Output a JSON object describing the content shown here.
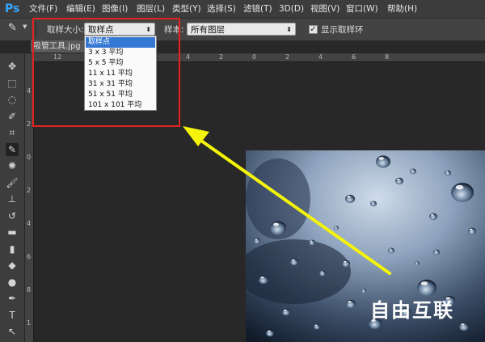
{
  "app": {
    "logo": "Ps"
  },
  "menu": [
    "文件(F)",
    "编辑(E)",
    "图像(I)",
    "图层(L)",
    "类型(Y)",
    "选择(S)",
    "滤镜(T)",
    "3D(D)",
    "视图(V)",
    "窗口(W)",
    "帮助(H)"
  ],
  "options": {
    "sample_size_label": "取样大小:",
    "sample_size_value": "取样点",
    "sample_label": "样本:",
    "sample_value": "所有图层",
    "show_ring_label": "显示取样环",
    "show_ring_checked": true
  },
  "dropdown": {
    "items": [
      "取样点",
      "3 x 3 平均",
      "5 x 5 平均",
      "11 x 11 平均",
      "31 x 31 平均",
      "51 x 51 平均",
      "101 x 101 平均"
    ],
    "selected_index": 0
  },
  "document": {
    "tab_title": "吸管工具.jpg @"
  },
  "ruler": {
    "horizontal": [
      "12",
      "10",
      "8",
      "6",
      "4",
      "2",
      "0",
      "2",
      "4",
      "6",
      "8"
    ],
    "vertical": [
      "4",
      "2",
      "0",
      "2",
      "4",
      "6",
      "8",
      "1"
    ]
  },
  "tools": [
    "move-icon",
    "marquee-icon",
    "lasso-icon",
    "quick-select-icon",
    "crop-icon",
    "eyedropper-icon",
    "healing-icon",
    "brush-icon",
    "stamp-icon",
    "history-brush-icon",
    "eraser-icon",
    "gradient-icon",
    "blur-icon",
    "dodge-icon",
    "pen-icon",
    "type-icon",
    "path-select-icon"
  ],
  "active_tool": "eyedropper-icon",
  "watermark": "自由互联",
  "colors": {
    "highlight": "#e52222",
    "arrow": "#f4f40a",
    "selection": "#3478d4"
  }
}
